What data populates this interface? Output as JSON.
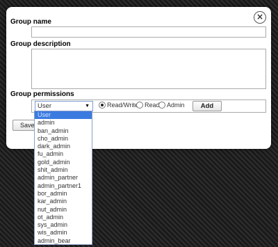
{
  "dialog": {
    "close_glyph": "×"
  },
  "fields": {
    "group_name_label": "Group name",
    "group_description_label": "Group description",
    "group_permissions_label": "Group permissions"
  },
  "permissions": {
    "selected_user": "User",
    "dropdown_arrow": "▼",
    "radio_options": [
      "Read/Write",
      "Read",
      "Admin"
    ],
    "selected_radio": "Read/Write",
    "add_label": "Add"
  },
  "save_label": "Save",
  "dropdown_options": [
    "User",
    "admin",
    "ban_admin",
    "cho_admin",
    "dark_admin",
    "fu_admin",
    "gold_admin",
    "shit_admin",
    "admin_partner",
    "admin_partner1",
    "bor_admin",
    "kar_admin",
    "nut_admin",
    "ot_admin",
    "sys_admin",
    "wis_admin",
    "admin_bear"
  ],
  "highlighted_option": "User",
  "colors": {
    "highlight": "#3b7be0",
    "background_stripe": "#2e2e2e"
  }
}
